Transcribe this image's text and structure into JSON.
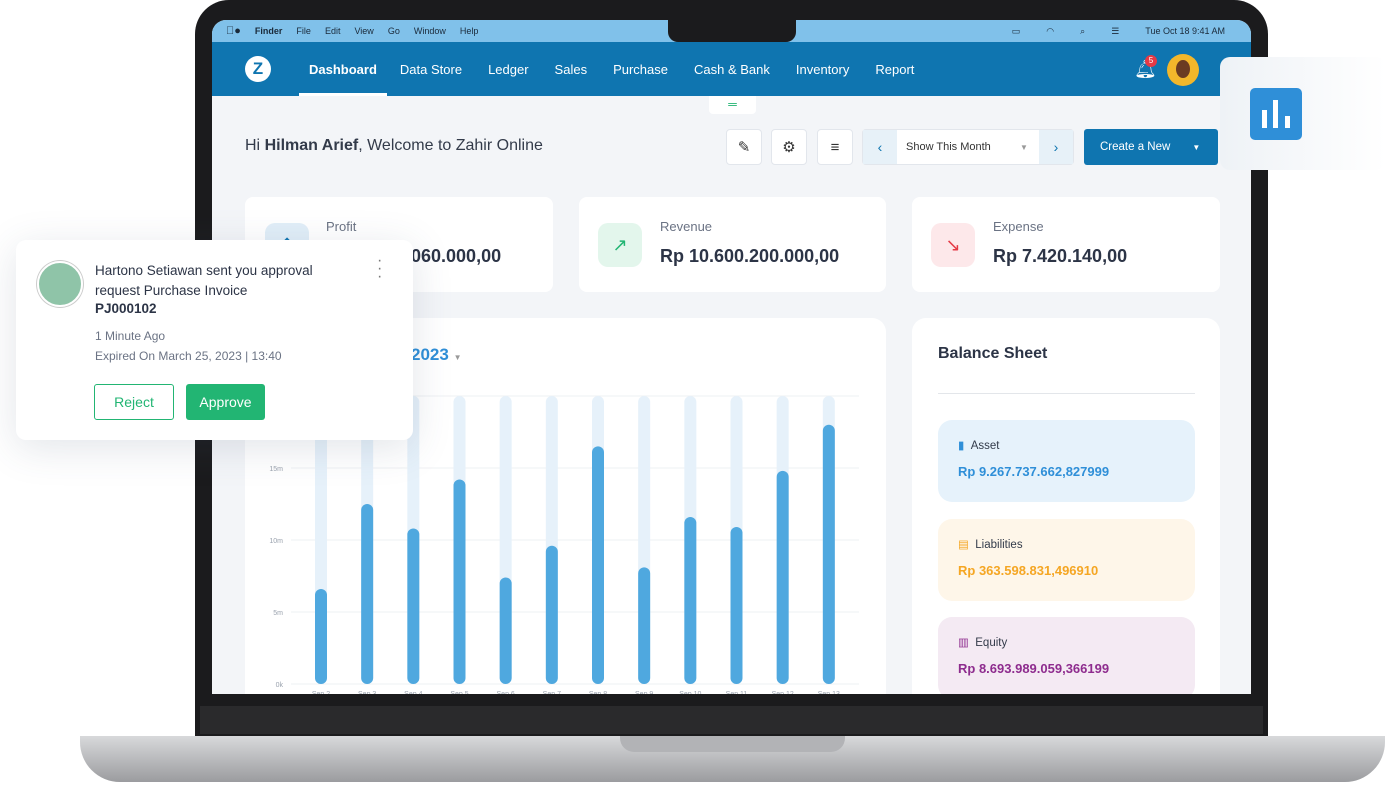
{
  "mac_menu": {
    "items": [
      "Finder",
      "File",
      "Edit",
      "View",
      "Go",
      "Window",
      "Help"
    ],
    "clock": "Tue Oct 18  9:41 AM"
  },
  "nav": {
    "logo": "Z",
    "items": [
      "Dashboard",
      "Data Store",
      "Ledger",
      "Sales",
      "Purchase",
      "Cash & Bank",
      "Inventory",
      "Report"
    ],
    "active": "Dashboard",
    "notification_count": "5"
  },
  "header": {
    "greeting": "Hi ",
    "user": "Hilman Arief",
    "welcome": ", Welcome to Zahir Online",
    "range": "Show This Month",
    "create": "Create a New"
  },
  "summary": [
    {
      "label": "Profit",
      "value": "060.000,00",
      "color": "#0f75b0"
    },
    {
      "label": "Revenue",
      "value": "Rp 10.600.200.000,00",
      "color": "#22b573"
    },
    {
      "label": "Expense",
      "value": "Rp 7.420.140,00",
      "color": "#e53945"
    }
  ],
  "chart_title_visible": "2023",
  "chart_data": {
    "type": "bar",
    "categories": [
      "Sep 2",
      "Sep 3",
      "Sep 4",
      "Sep 5",
      "Sep 6",
      "Sep 7",
      "Sep 8",
      "Sep 9",
      "Sep 10",
      "Sep 11",
      "Sep 12",
      "Sep 13"
    ],
    "values": [
      6.6,
      12.5,
      10.8,
      14.2,
      7.4,
      9.6,
      16.5,
      8.1,
      11.6,
      10.9,
      14.8,
      18.0
    ],
    "unit": "m",
    "ylim": [
      0,
      20
    ],
    "yticks": [
      "0k",
      "5m",
      "10m",
      "15m"
    ],
    "grid": true,
    "bar_color": "#4fa8df",
    "track_color": "#e6f1fa"
  },
  "balance_sheet": {
    "title": "Balance Sheet",
    "items": [
      {
        "label": "Asset",
        "value": "Rp 9.267.737.662,827999",
        "color": "#2f8fd8",
        "bg": "#e6f2fb"
      },
      {
        "label": "Liabilities",
        "value": "Rp 363.598.831,496910",
        "color": "#f5a623",
        "bg": "#fef6e9"
      },
      {
        "label": "Equity",
        "value": "Rp 8.693.989.059,366199",
        "color": "#8e2c8e",
        "bg": "#f4eaf3"
      }
    ]
  },
  "notification": {
    "message": "Hartono Setiawan sent you approval request Purchase Invoice",
    "doc": "PJ000102",
    "time": "1 Minute Ago",
    "expiry": "Expired On March 25, 2023 | 13:40",
    "reject": "Reject",
    "approve": "Approve"
  }
}
